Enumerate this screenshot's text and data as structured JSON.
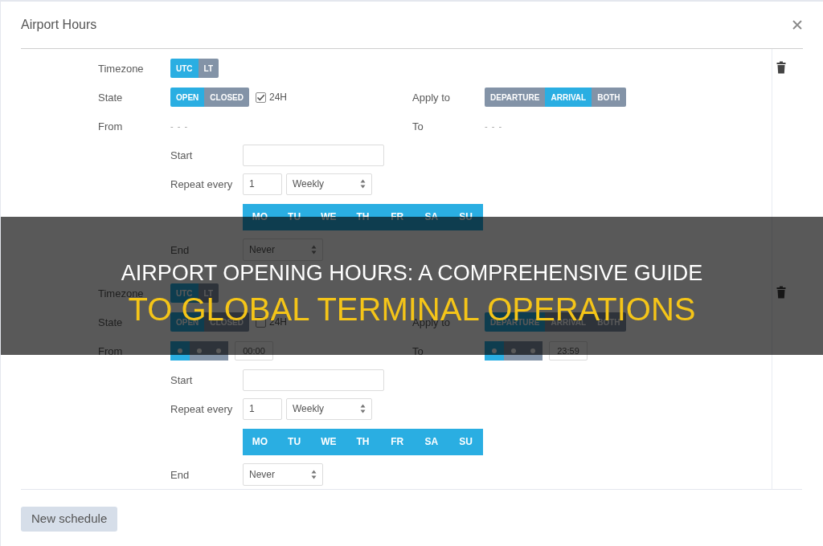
{
  "dialog": {
    "title": "Airport Hours"
  },
  "schedules": [
    {
      "timezone": {
        "label": "Timezone",
        "options": [
          {
            "label": "UTC",
            "selected": true
          },
          {
            "label": "LT",
            "selected": false
          }
        ]
      },
      "state": {
        "label": "State",
        "options": [
          {
            "label": "OPEN",
            "selected": true
          },
          {
            "label": "CLOSED",
            "selected": false
          }
        ],
        "all_day": {
          "label": "24H",
          "checked": true
        }
      },
      "apply_to": {
        "label": "Apply to",
        "options": [
          {
            "label": "DEPARTURE",
            "selected": false
          },
          {
            "label": "ARRIVAL",
            "selected": true
          },
          {
            "label": "BOTH",
            "selected": false
          }
        ]
      },
      "from": {
        "label": "From",
        "kind": "none",
        "text": "- - -"
      },
      "to": {
        "label": "To",
        "kind": "none",
        "text": "- - -"
      },
      "start": {
        "label": "Start"
      },
      "repeat": {
        "label": "Repeat every",
        "interval": "1",
        "unit": "Weekly"
      },
      "days": [
        {
          "label": "MO",
          "selected": true
        },
        {
          "label": "TU",
          "selected": true
        },
        {
          "label": "WE",
          "selected": true
        },
        {
          "label": "TH",
          "selected": true
        },
        {
          "label": "FR",
          "selected": true
        },
        {
          "label": "SA",
          "selected": true
        },
        {
          "label": "SU",
          "selected": true
        }
      ],
      "end": {
        "label": "End",
        "value": "Never"
      }
    },
    {
      "timezone": {
        "label": "Timezone",
        "options": [
          {
            "label": "UTC",
            "selected": true
          },
          {
            "label": "LT",
            "selected": false
          }
        ]
      },
      "state": {
        "label": "State",
        "options": [
          {
            "label": "OPEN",
            "selected": true
          },
          {
            "label": "CLOSED",
            "selected": false
          }
        ],
        "all_day": {
          "label": "24H",
          "checked": false
        }
      },
      "apply_to": {
        "label": "Apply to",
        "options": [
          {
            "label": "DEPARTURE",
            "selected": true
          },
          {
            "label": "ARRIVAL",
            "selected": false
          },
          {
            "label": "BOTH",
            "selected": false
          }
        ]
      },
      "from": {
        "label": "From",
        "kind": "time",
        "segments": [
          {
            "selected": true
          },
          {
            "selected": false
          },
          {
            "selected": false
          }
        ],
        "value": "00:00"
      },
      "to": {
        "label": "To",
        "kind": "time",
        "segments": [
          {
            "selected": true
          },
          {
            "selected": false
          },
          {
            "selected": false
          }
        ],
        "value": "23:59"
      },
      "start": {
        "label": "Start"
      },
      "repeat": {
        "label": "Repeat every",
        "interval": "1",
        "unit": "Weekly"
      },
      "days": [
        {
          "label": "MO",
          "selected": true
        },
        {
          "label": "TU",
          "selected": true
        },
        {
          "label": "WE",
          "selected": true
        },
        {
          "label": "TH",
          "selected": true
        },
        {
          "label": "FR",
          "selected": true
        },
        {
          "label": "SA",
          "selected": true
        },
        {
          "label": "SU",
          "selected": true
        }
      ],
      "end": {
        "label": "End",
        "value": "Never"
      }
    }
  ],
  "footer": {
    "button": "New schedule"
  },
  "banner": {
    "headline": "AIRPORT OPENING HOURS: A COMPREHENSIVE GUIDE",
    "tagline": "TO GLOBAL TERMINAL OPERATIONS"
  }
}
